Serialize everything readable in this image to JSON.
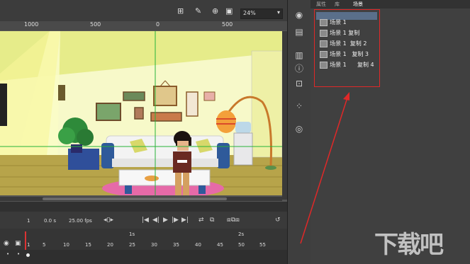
{
  "stage": {
    "zoom": "24%",
    "ruler_labels": [
      "1000",
      "500",
      "0",
      "500"
    ]
  },
  "panel": {
    "tabs": [
      "属性",
      "库",
      "场景"
    ],
    "scenes": [
      "场景 1",
      "场景 1 复制",
      "场景 1  复制 2",
      "场景 1   复制 3",
      "场景 1      复制 4"
    ]
  },
  "timeline": {
    "frame": "1",
    "time": "0.0 s",
    "fps": "25.00 fps",
    "second_marks": [
      "1s",
      "2s"
    ],
    "frame_numbers": [
      "1",
      "5",
      "10",
      "15",
      "20",
      "25",
      "30",
      "35",
      "40",
      "45",
      "50",
      "55"
    ]
  },
  "watermark": "下载吧",
  "colors": {
    "stage_bg": "#f2f4b8",
    "panel_bg": "#404040",
    "highlight": "#e02828"
  }
}
